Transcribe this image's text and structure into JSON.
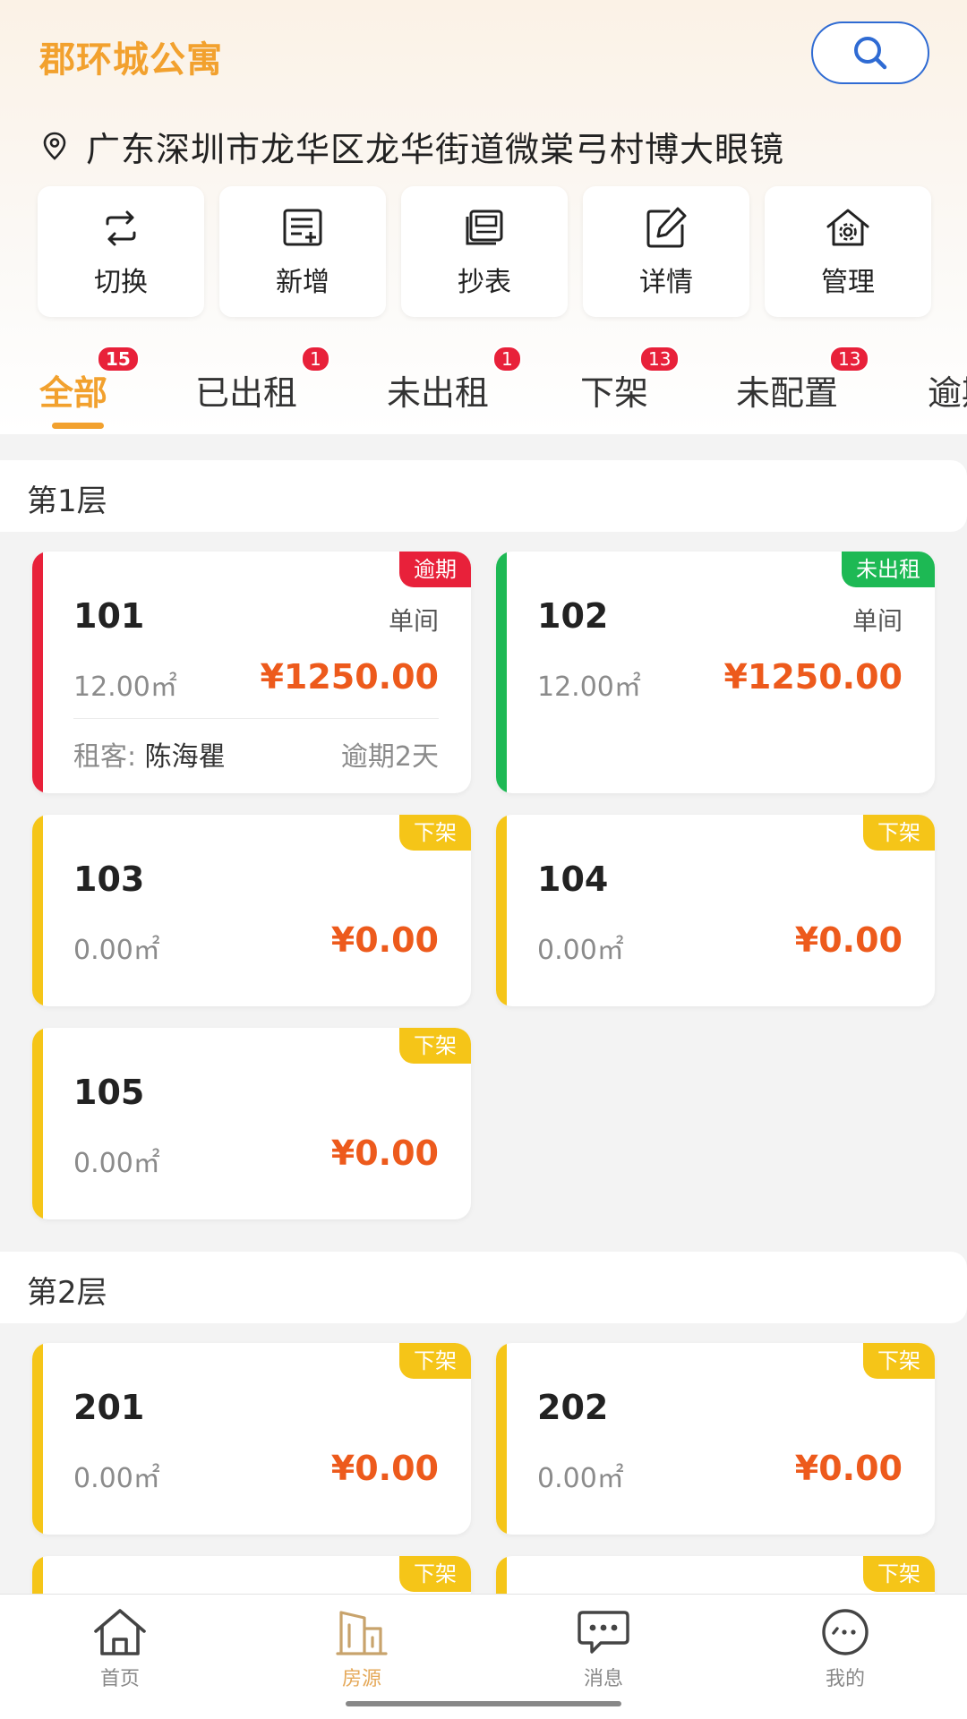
{
  "app": {
    "title": "郡环城公寓"
  },
  "address": "广东深圳市龙华区龙华街道微棠弓村博大眼镜",
  "actions": [
    {
      "label": "切换",
      "icon": "switch-icon"
    },
    {
      "label": "新增",
      "icon": "add-note-icon"
    },
    {
      "label": "抄表",
      "icon": "meter-icon"
    },
    {
      "label": "详情",
      "icon": "edit-icon"
    },
    {
      "label": "管理",
      "icon": "house-settings-icon"
    }
  ],
  "tabs": [
    {
      "label": "全部",
      "badge": "15"
    },
    {
      "label": "已出租",
      "badge": "1"
    },
    {
      "label": "未出租",
      "badge": "1"
    },
    {
      "label": "下架",
      "badge": "13"
    },
    {
      "label": "未配置",
      "badge": "13"
    },
    {
      "label": "逾期",
      "badge": ""
    }
  ],
  "floors": [
    {
      "name": "第1层",
      "rooms": [
        {
          "no": "101",
          "type": "单间",
          "area": "12.00㎡",
          "price": "¥1250.00",
          "tag": "逾期",
          "status_color": "#e8213a",
          "tenant_label": "租客:",
          "tenant_name": "陈海瞿",
          "overdue_text": "逾期2天"
        },
        {
          "no": "102",
          "type": "单间",
          "area": "12.00㎡",
          "price": "¥1250.00",
          "tag": "未出租",
          "status_color": "#1db954"
        },
        {
          "no": "103",
          "type": "",
          "area": "0.00㎡",
          "price": "¥0.00",
          "tag": "下架",
          "status_color": "#f5c518"
        },
        {
          "no": "104",
          "type": "",
          "area": "0.00㎡",
          "price": "¥0.00",
          "tag": "下架",
          "status_color": "#f5c518"
        },
        {
          "no": "105",
          "type": "",
          "area": "0.00㎡",
          "price": "¥0.00",
          "tag": "下架",
          "status_color": "#f5c518"
        }
      ]
    },
    {
      "name": "第2层",
      "rooms": [
        {
          "no": "201",
          "type": "",
          "area": "0.00㎡",
          "price": "¥0.00",
          "tag": "下架",
          "status_color": "#f5c518"
        },
        {
          "no": "202",
          "type": "",
          "area": "0.00㎡",
          "price": "¥0.00",
          "tag": "下架",
          "status_color": "#f5c518"
        },
        {
          "no": "",
          "type": "",
          "area": "",
          "price": "",
          "tag": "下架",
          "status_color": "#f5c518"
        },
        {
          "no": "",
          "type": "",
          "area": "",
          "price": "",
          "tag": "下架",
          "status_color": "#f5c518"
        }
      ]
    }
  ],
  "nav": [
    {
      "label": "首页",
      "icon": "home-icon"
    },
    {
      "label": "房源",
      "icon": "building-icon",
      "active": true
    },
    {
      "label": "消息",
      "icon": "message-icon"
    },
    {
      "label": "我的",
      "icon": "profile-icon"
    }
  ],
  "colors": {
    "accent": "#f2a12e",
    "price": "#ed5a1c",
    "badge": "#e8213a",
    "search_border": "#2f6bd3"
  }
}
